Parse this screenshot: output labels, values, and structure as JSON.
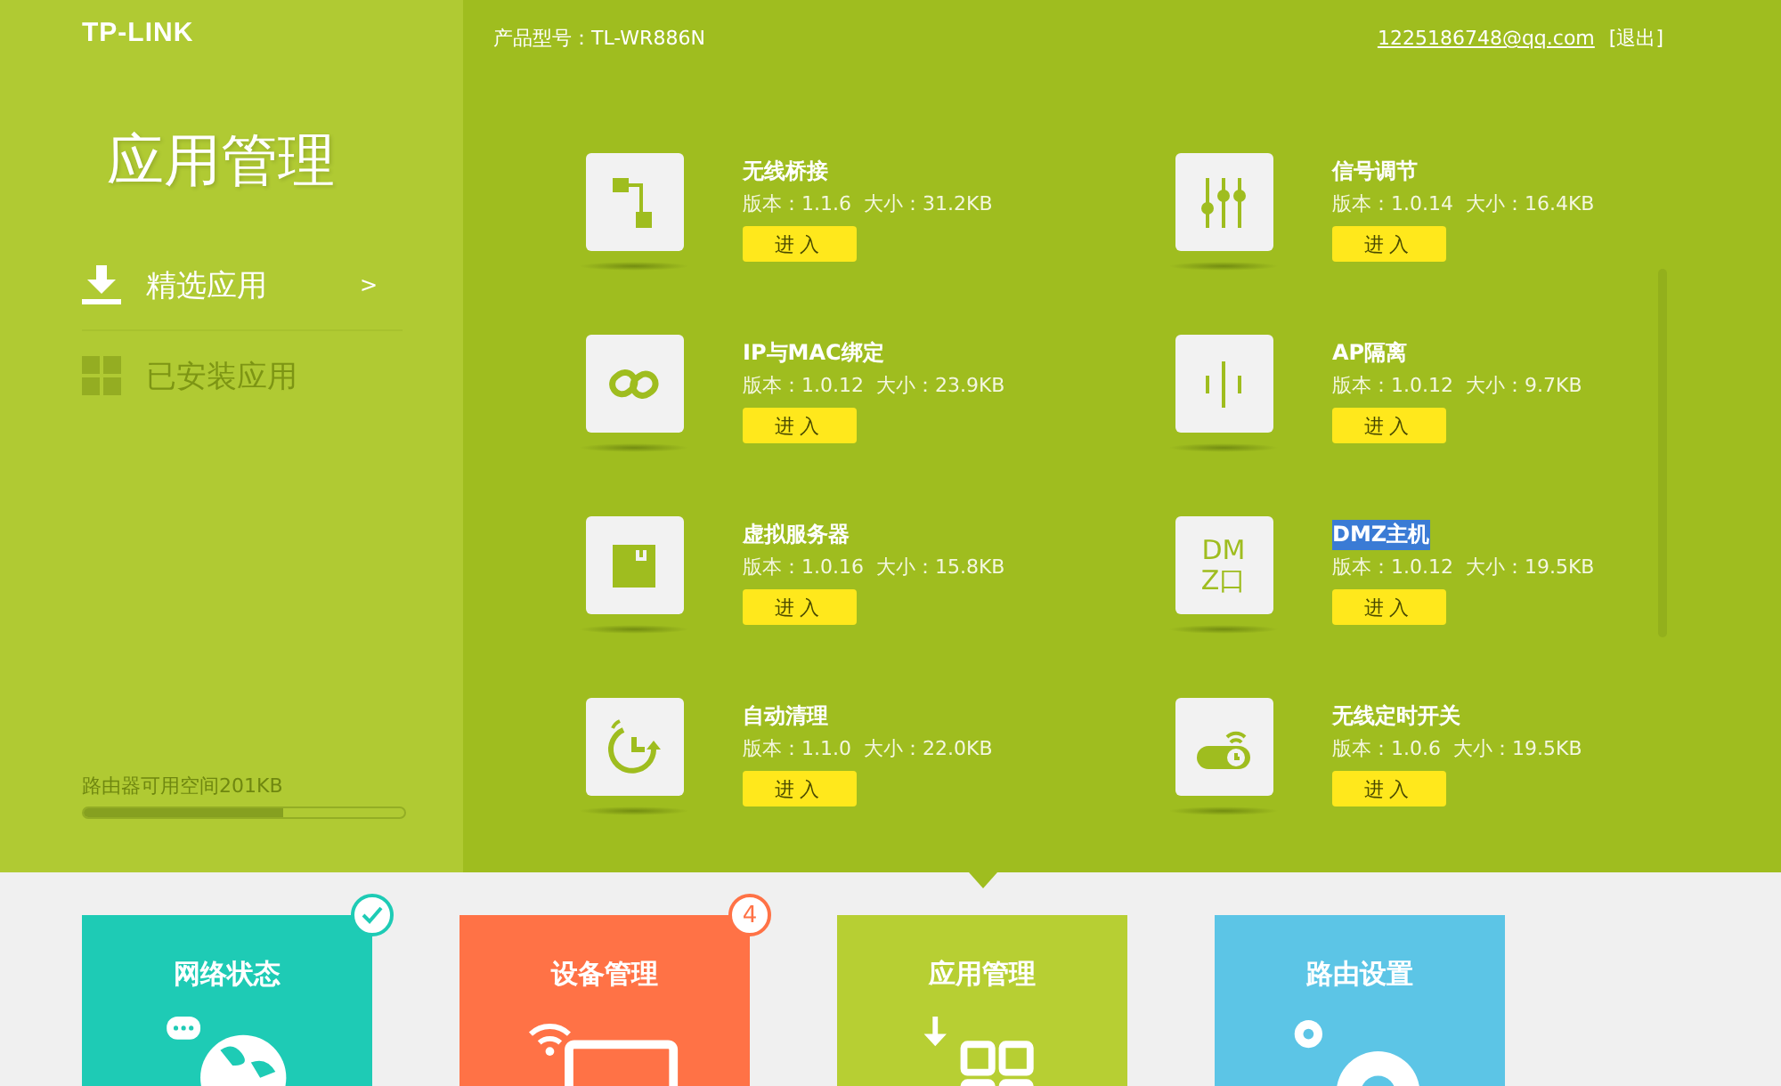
{
  "header": {
    "logo": "TP-LINK",
    "model": "产品型号：TL-WR886N",
    "account": "1225186748@qq.com",
    "logout": "[退出]"
  },
  "sidebar": {
    "title": "应用管理",
    "items": [
      {
        "label": "精选应用",
        "selected": true,
        "arrow": ">"
      },
      {
        "label": "已安装应用",
        "selected": false
      }
    ],
    "storage": {
      "label": "路由器可用空间201KB",
      "level": 0.62
    }
  },
  "apps": [
    {
      "name": "无线桥接",
      "info": "版本：1.1.6  大小：31.2KB",
      "button": "进入",
      "text_selected": false
    },
    {
      "name": "信号调节",
      "info": "版本：1.0.14  大小：16.4KB",
      "button": "进入",
      "text_selected": false
    },
    {
      "name": "IP与MAC绑定",
      "info": "版本：1.0.12  大小：23.9KB",
      "button": "进入",
      "text_selected": false
    },
    {
      "name": "AP隔离",
      "info": "版本：1.0.12  大小：9.7KB",
      "button": "进入",
      "text_selected": false
    },
    {
      "name": "虚拟服务器",
      "info": "版本：1.0.16  大小：15.8KB",
      "button": "进入",
      "text_selected": false
    },
    {
      "name": "DMZ主机",
      "info": "版本：1.0.12  大小：19.5KB",
      "button": "进入",
      "text_selected": true,
      "icon_text": [
        "DM",
        "Z口"
      ]
    },
    {
      "name": "自动清理",
      "info": "版本：1.1.0  大小：22.0KB",
      "button": "进入",
      "text_selected": false
    },
    {
      "name": "无线定时开关",
      "info": "版本：1.0.6  大小：19.5KB",
      "button": "进入",
      "text_selected": false
    }
  ],
  "tiles": [
    {
      "label": "网络状态",
      "color": "#1ecbb5",
      "selected": false,
      "badge": {
        "kind": "check"
      }
    },
    {
      "label": "设备管理",
      "color": "#ff7246",
      "selected": false,
      "badge": {
        "kind": "count",
        "text": "4"
      }
    },
    {
      "label": "应用管理",
      "color": "#b7cf33",
      "selected": true
    },
    {
      "label": "路由设置",
      "color": "#5cc5e6",
      "selected": false
    }
  ]
}
